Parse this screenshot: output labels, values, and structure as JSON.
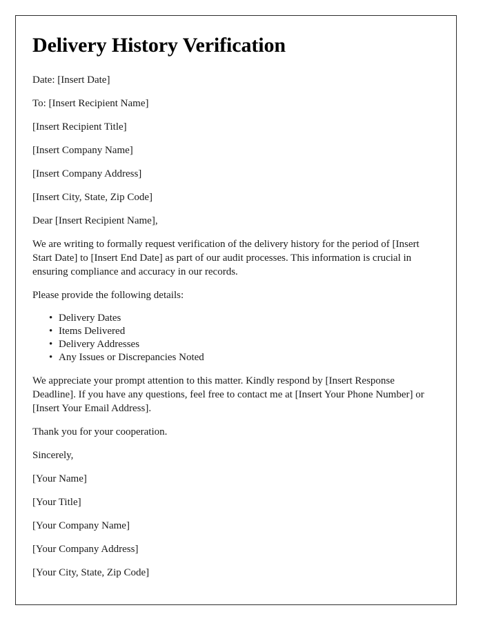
{
  "document": {
    "title": "Delivery History Verification",
    "date_line": "Date: [Insert Date]",
    "recipient": {
      "to_line": "To: [Insert Recipient Name]",
      "title_line": "[Insert Recipient Title]",
      "company_line": "[Insert Company Name]",
      "address_line": "[Insert Company Address]",
      "city_state_zip_line": "[Insert City, State, Zip Code]"
    },
    "salutation": "Dear [Insert Recipient Name],",
    "body": {
      "opening_paragraph": "We are writing to formally request verification of the delivery history for the period of [Insert Start Date] to [Insert End Date] as part of our audit processes. This information is crucial in ensuring compliance and accuracy in our records.",
      "list_intro": "Please provide the following details:",
      "details_list": [
        "Delivery Dates",
        "Items Delivered",
        "Delivery Addresses",
        "Any Issues or Discrepancies Noted"
      ],
      "bullet_glyph": "•",
      "closing_paragraph": "We appreciate your prompt attention to this matter. Kindly respond by [Insert Response Deadline]. If you have any questions, feel free to contact me at [Insert Your Phone Number] or [Insert Your Email Address].",
      "thanks_line": "Thank you for your cooperation."
    },
    "signature": {
      "closing": "Sincerely,",
      "name_line": "[Your Name]",
      "title_line": "[Your Title]",
      "company_line": "[Your Company Name]",
      "address_line": "[Your Company Address]",
      "city_state_zip_line": "[Your City, State, Zip Code]"
    }
  },
  "style": {
    "page_background": "#ffffff",
    "border_color": "#2b2b2b",
    "text_color": "#1a1a1a"
  }
}
